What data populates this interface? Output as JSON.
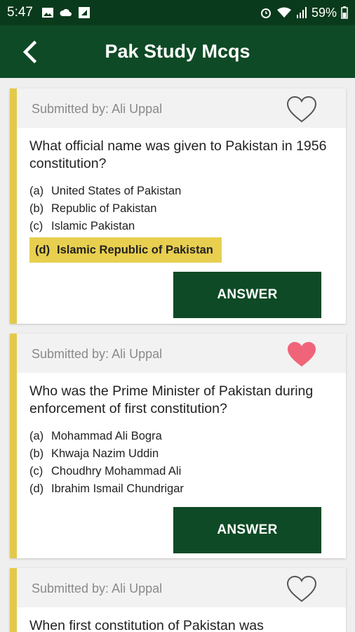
{
  "status_bar": {
    "time": "5:47",
    "battery": "59%",
    "left_icons": [
      "image-icon",
      "cloud-icon",
      "app-icon"
    ],
    "right_icons": [
      "alarm-icon",
      "wifi-icon",
      "signal-icon",
      "battery-icon"
    ]
  },
  "app_bar": {
    "title": "Pak Study Mcqs",
    "back_icon": "back-arrow-icon"
  },
  "colors": {
    "primary": "#0e4a25",
    "status_bar": "#0a3a1c",
    "accent_yellow": "#e3c94a",
    "heart_active": "#f0647a"
  },
  "cards": [
    {
      "submitted_by": "Submitted by: Ali Uppal",
      "favorited": false,
      "question": "What official name was given to Pakistan in 1956 constitution?",
      "options": [
        {
          "key": "(a)",
          "text": "United States of Pakistan"
        },
        {
          "key": "(b)",
          "text": "Republic of Pakistan"
        },
        {
          "key": "(c)",
          "text": "Islamic Pakistan"
        },
        {
          "key": "(d)",
          "text": "Islamic Republic of Pakistan",
          "correct": true
        }
      ],
      "answer_label": "ANSWER"
    },
    {
      "submitted_by": "Submitted by: Ali Uppal",
      "favorited": true,
      "question": "Who was the Prime Minister of Pakistan during enforcement of first constitution?",
      "options": [
        {
          "key": "(a)",
          "text": "Mohammad Ali Bogra"
        },
        {
          "key": "(b)",
          "text": "Khwaja Nazim Uddin"
        },
        {
          "key": "(c)",
          "text": "Choudhry Mohammad Ali"
        },
        {
          "key": "(d)",
          "text": "Ibrahim Ismail Chundrigar"
        }
      ],
      "answer_label": "ANSWER"
    },
    {
      "submitted_by": "Submitted by: Ali Uppal",
      "favorited": false,
      "question": "When first constitution of Pakistan was"
    }
  ]
}
